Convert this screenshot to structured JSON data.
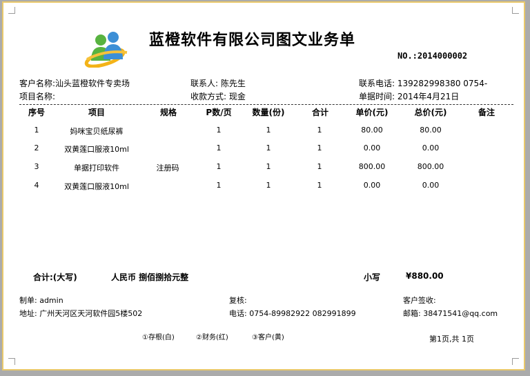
{
  "title": "蓝橙软件有限公司图文业务单",
  "order_no": "NO.:2014000002",
  "header": {
    "customer": "客户名称:汕头蓝橙软件专卖场",
    "contact": "联系人: 陈先生",
    "phone": "联系电话: 139282998380 0754-",
    "project": "项目名称:",
    "payment": "收款方式:  现金",
    "date": "单据时间: 2014年4月21日"
  },
  "columns": [
    "序号",
    "项目",
    "规格",
    "P数/页",
    "数量(份)",
    "合计",
    "单价(元)",
    "总价(元)",
    "备注"
  ],
  "rows": [
    {
      "no": "1",
      "item": "妈咪宝贝纸尿裤",
      "spec": "",
      "pages": "1",
      "qty": "1",
      "total": "1",
      "price": "80.00",
      "amount": "80.00",
      "remark": ""
    },
    {
      "no": "2",
      "item": "双黄莲口服液10ml",
      "spec": "",
      "pages": "1",
      "qty": "1",
      "total": "1",
      "price": "0.00",
      "amount": "0.00",
      "remark": ""
    },
    {
      "no": "3",
      "item": "单据打印软件",
      "spec": "注册码",
      "pages": "1",
      "qty": "1",
      "total": "1",
      "price": "800.00",
      "amount": "800.00",
      "remark": ""
    },
    {
      "no": "4",
      "item": "双黄莲口服液10ml",
      "spec": "",
      "pages": "1",
      "qty": "1",
      "total": "1",
      "price": "0.00",
      "amount": "0.00",
      "remark": ""
    }
  ],
  "summary": {
    "label": "合计:(大写)",
    "amount_words": "人民币 捌佰捌拾元整",
    "subtotal_label": "小写",
    "subtotal": "¥880.00"
  },
  "footer": {
    "maker": "制单: admin",
    "review": "复核:",
    "sign": "客户签收:",
    "address": "地址: 广州天河区天河软件园5楼502",
    "tel": "电话: 0754-89982922 082991899",
    "email": "邮箱: 38471541@qq.com",
    "copy1": "①存根(白)",
    "copy2": "②财务(红)",
    "copy3": "③客户(黄)",
    "page": "第1页,共 1页"
  },
  "colors": {
    "border": "#e9c86a",
    "background": "#ababab",
    "paper": "#ffffff"
  },
  "icons": {
    "logo": "msn-people-icon"
  }
}
